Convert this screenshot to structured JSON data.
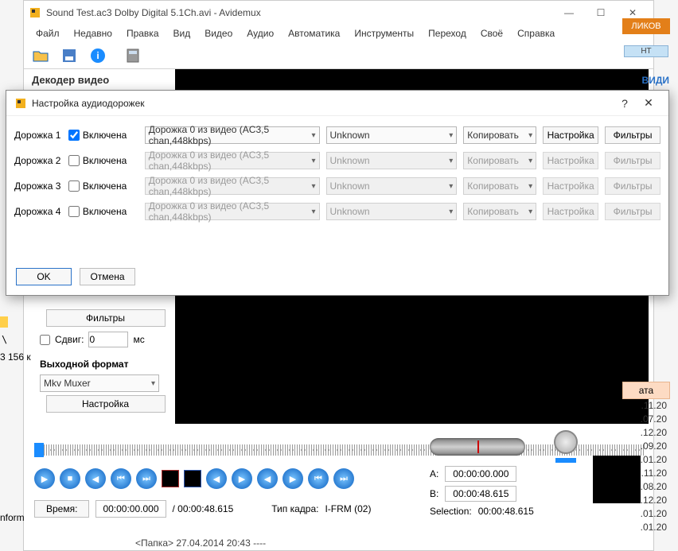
{
  "window": {
    "title": "Sound Test.ac3 Dolby Digital 5.1Ch.avi - Avidemux"
  },
  "menu": {
    "file": "Файл",
    "recent": "Недавно",
    "edit": "Правка",
    "view": "Вид",
    "video": "Видео",
    "audio": "Аудио",
    "auto": "Автоматика",
    "tools": "Инструменты",
    "go": "Переход",
    "custom": "Своё",
    "help": "Справка"
  },
  "section": {
    "video_decoder": "Декодер видео",
    "output_format": "Выходной формат"
  },
  "left": {
    "filters_btn": "Фильтры",
    "shift_label": "Сдвиг:",
    "shift_value": "0",
    "shift_unit": "мс",
    "mux_value": "Mkv Muxer",
    "configure_btn": "Настройка"
  },
  "time": {
    "label": "Время:",
    "current": "00:00:00.000",
    "total": "/ 00:00:48.615",
    "frame_type_label": "Тип кадра:",
    "frame_type_value": "I-FRM (02)"
  },
  "sel": {
    "a_label": "A:",
    "a_value": "00:00:00.000",
    "b_label": "B:",
    "b_value": "00:00:48.615",
    "selection_label": "Selection:",
    "selection_value": "00:00:48.615"
  },
  "status": "<Папка>  27.04.2014 20:43  ----",
  "side": {
    "top_tab": "ЛИКОВ",
    "tab2": "HT",
    "tab3": "ВИДИ",
    "header": "ата",
    "d0": ".11.20",
    "d1": ".07.20",
    "d2": ".12.20",
    "d3": ".09.20",
    "d4": ".01.20",
    "d5": ".11.20",
    "d6": ".08.20",
    "d7": ".12.20",
    "d8": ".01.20",
    "d9": ".01.20"
  },
  "leftpanel": {
    "br": "3 156 к",
    "inform": "nform"
  },
  "dialog": {
    "title": "Настройка аудиодорожек",
    "enabled_label": "Включена",
    "track_label_prefix": "Дорожка",
    "source": "Дорожка 0 из видео (AC3,5 chan,448kbps)",
    "unknown": "Unknown",
    "copy": "Копировать",
    "configure": "Настройка",
    "filters": "Фильтры",
    "ok": "OK",
    "cancel": "Отмена",
    "tracks": [
      {
        "n": "1",
        "enabled": true
      },
      {
        "n": "2",
        "enabled": false
      },
      {
        "n": "3",
        "enabled": false
      },
      {
        "n": "4",
        "enabled": false
      }
    ]
  }
}
